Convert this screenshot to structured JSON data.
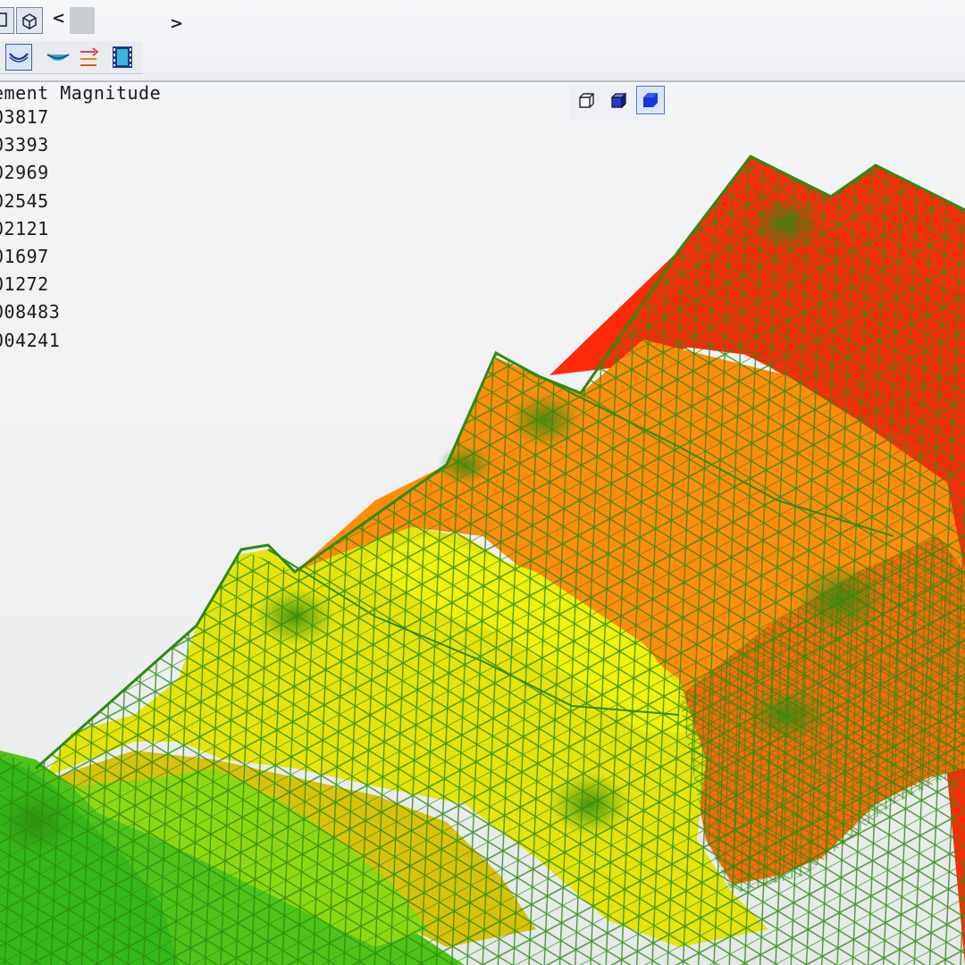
{
  "legend": {
    "title": "ement Magnitude",
    "values": [
      "03817",
      "03393",
      "02969",
      "02545",
      "02121",
      "01697",
      "01272",
      "008483",
      "004241"
    ]
  },
  "toolbar": {
    "nav_prev": "<",
    "nav_next": ">"
  },
  "icons": {
    "row1": [
      "view-mode-icon",
      "wireframe-cube-icon",
      "chevron-left-icon",
      "scroll-thumb",
      "chevron-right-icon"
    ],
    "row2": [
      "deformed-shape-icon",
      "undeformed-shape-icon",
      "results-surface-icon",
      "vector-arrows-icon",
      "animation-film-icon"
    ],
    "view": [
      "wireframe-view-icon",
      "shaded-edges-view-icon",
      "shaded-view-icon"
    ]
  },
  "view_modes": {
    "active": "shaded-view"
  },
  "colors": {
    "mesh_lines": "#2f8a0f",
    "legend_scale": [
      "#ff2a0a",
      "#ff5a0a",
      "#ff8c0a",
      "#f2b30a",
      "#e6d70a",
      "#c9e60a",
      "#8fd810",
      "#4ec41a",
      "#35b81a"
    ]
  }
}
